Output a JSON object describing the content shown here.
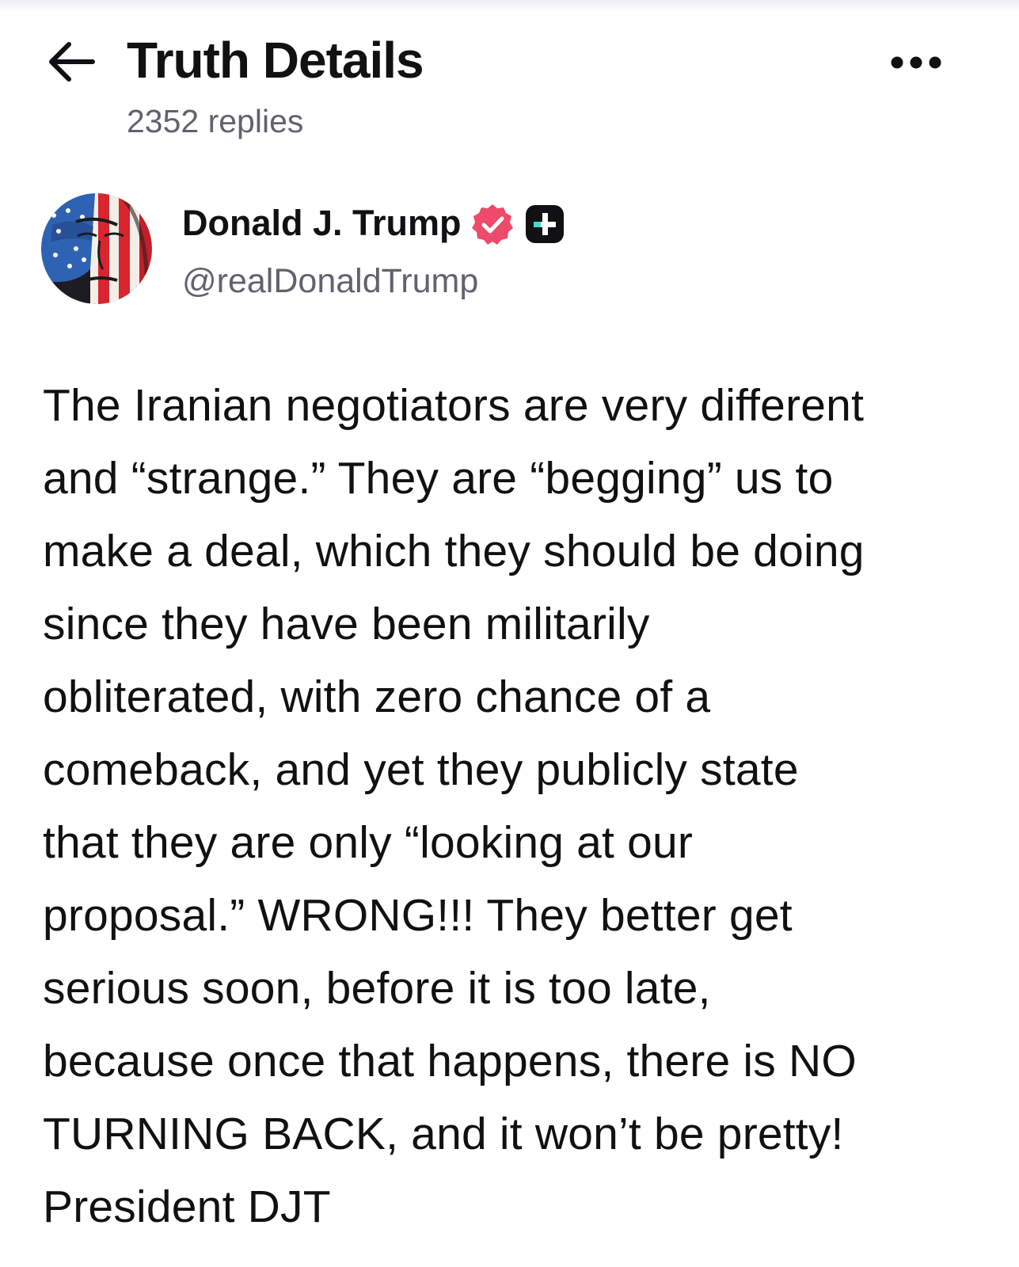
{
  "header": {
    "title": "Truth Details",
    "replies_label": "2352 replies",
    "back_icon": "arrow-left-icon",
    "more_icon": "more-horizontal-icon"
  },
  "post": {
    "author": {
      "display_name": "Donald J. Trump",
      "handle": "@realDonaldTrump",
      "verified_icon": "verified-badge-icon",
      "plus_icon": "truth-plus-badge-icon"
    },
    "lines": [
      "The Iranian negotiators are very different",
      "and “strange.” They are “begging” us to",
      "make a deal, which they should be doing",
      "since they have been militarily",
      "obliterated, with zero chance of a",
      "comeback, and yet they publicly state",
      "that they are only “looking at our",
      "proposal.” WRONG!!! They better get",
      "serious soon, before it is too late,",
      "because once that happens, there is NO",
      "TURNING BACK, and it won’t be pretty!",
      "President DJT"
    ]
  },
  "colors": {
    "text_primary": "#111114",
    "text_secondary": "#62626e",
    "verified_badge": "#ee4a6c",
    "plus_badge_bg": "#111114",
    "plus_badge_accent": "#37dfc8"
  }
}
